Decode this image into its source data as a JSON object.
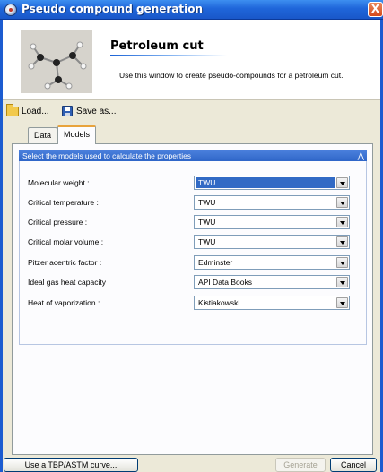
{
  "window": {
    "title": "Pseudo compound generation",
    "close_label": "X"
  },
  "header": {
    "title": "Petroleum cut",
    "description": "Use this window to create pseudo-compounds for a petroleum cut."
  },
  "toolbar": {
    "load_label": "Load...",
    "save_as_label": "Save as..."
  },
  "tabs": [
    {
      "label": "Data",
      "active": false
    },
    {
      "label": "Models",
      "active": true
    }
  ],
  "models_section": {
    "header": "Select the models used to calculate the properties",
    "collapse_glyph": "«",
    "properties": [
      {
        "label": "Molecular weight :",
        "value": "TWU",
        "selected": true
      },
      {
        "label": "Critical temperature :",
        "value": "TWU",
        "selected": false
      },
      {
        "label": "Critical pressure :",
        "value": "TWU",
        "selected": false
      },
      {
        "label": "Critical molar volume :",
        "value": "TWU",
        "selected": false
      },
      {
        "label": "Pitzer acentric factor :",
        "value": "Edminster",
        "selected": false
      },
      {
        "label": "Ideal gas heat capacity :",
        "value": "API Data Books",
        "selected": false
      },
      {
        "label": "Heat of vaporization :",
        "value": "Kistiakowski",
        "selected": false
      }
    ]
  },
  "buttons": {
    "tbp_label": "Use a TBP/ASTM curve...",
    "generate_label": "Generate",
    "cancel_label": "Cancel"
  },
  "colors": {
    "titlebar": "#1f66da",
    "selection": "#316ac5",
    "section_header": "#2f66c8",
    "close_button": "#d44a1c"
  }
}
